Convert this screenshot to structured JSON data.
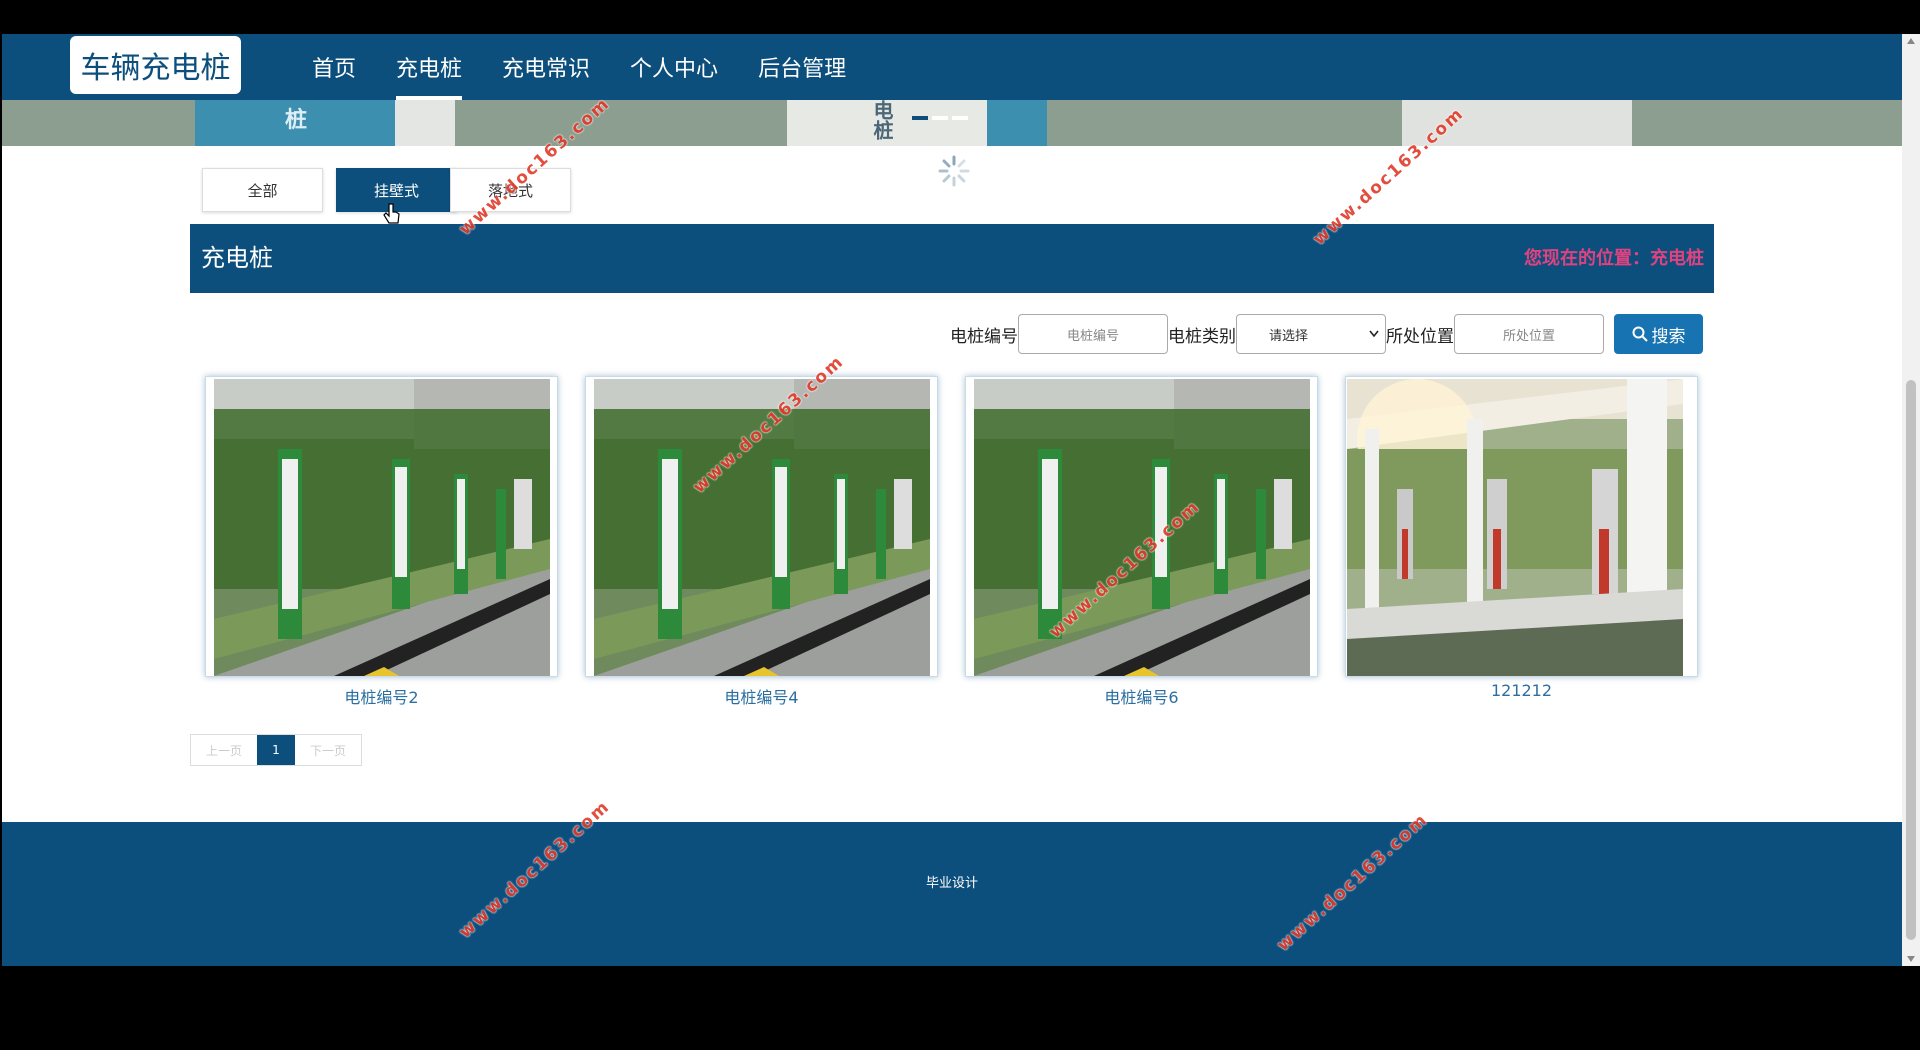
{
  "site": {
    "logo": "车辆充电桩"
  },
  "nav": {
    "items": [
      {
        "label": "首页"
      },
      {
        "label": "充电桩"
      },
      {
        "label": "充电常识"
      },
      {
        "label": "个人中心"
      },
      {
        "label": "后台管理"
      }
    ],
    "active": "充电桩"
  },
  "banner": {
    "text_left": "桩",
    "text_right": "电桩"
  },
  "filters": {
    "all": "全部",
    "wall": "挂壁式",
    "floor": "落地式",
    "active": "挂壁式"
  },
  "section": {
    "title": "充电桩",
    "location": "您现在的位置：充电桩"
  },
  "search": {
    "code_label": "电桩编号",
    "code_placeholder": "电桩编号",
    "type_label": "电桩类别",
    "type_selected": "请选择",
    "location_label": "所处位置",
    "location_placeholder": "所处位置",
    "button": "搜索"
  },
  "cards": [
    {
      "caption": "电桩编号2",
      "image": "green-charging-posts"
    },
    {
      "caption": "电桩编号4",
      "image": "green-charging-posts"
    },
    {
      "caption": "电桩编号6",
      "image": "green-charging-posts"
    },
    {
      "caption": "121212",
      "image": "canopy-charging-station"
    }
  ],
  "pagination": {
    "prev": "上一页",
    "current": "1",
    "next": "下一页"
  },
  "footer": {
    "text": "毕业设计"
  },
  "watermark": "www.doc163.com",
  "colors": {
    "primary": "#0c4f7d",
    "location": "#e0427f",
    "search_button": "#1873b3",
    "caption": "#2b6fa2"
  }
}
